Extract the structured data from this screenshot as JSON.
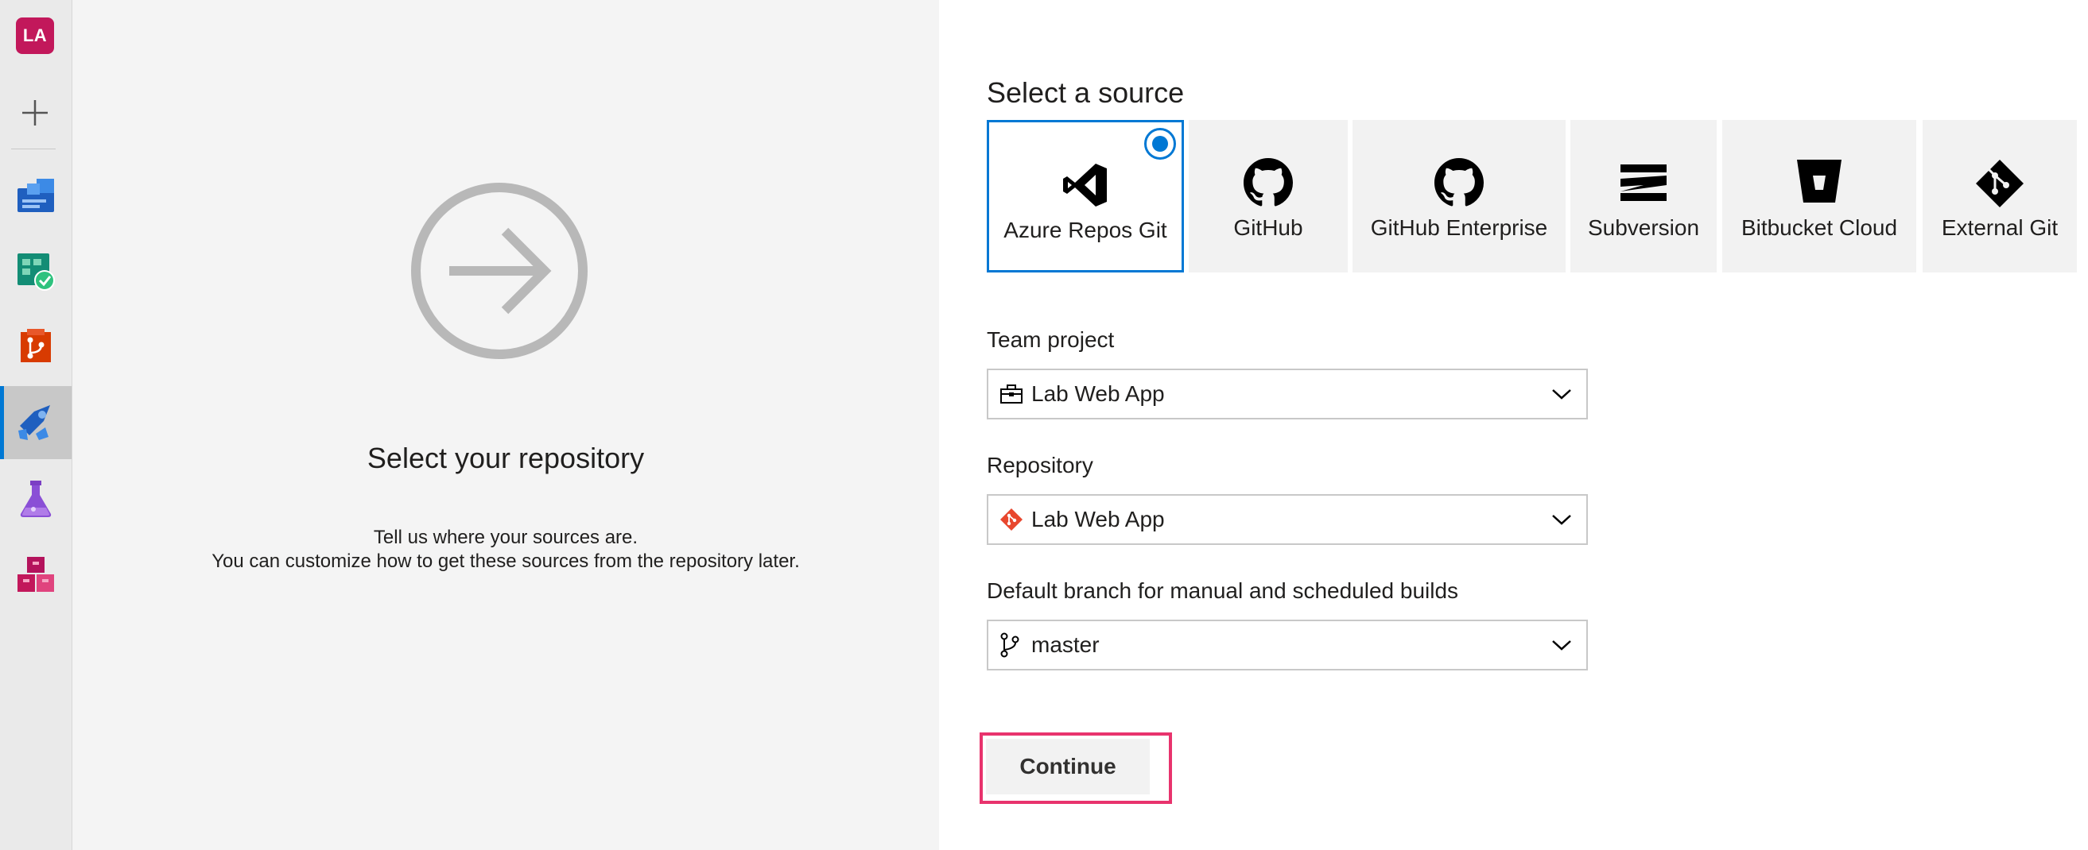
{
  "rail": {
    "avatar_initials": "LA",
    "items": [
      {
        "name": "overview-icon"
      },
      {
        "name": "boards-icon"
      },
      {
        "name": "repos-icon"
      },
      {
        "name": "pipelines-icon",
        "active": true
      },
      {
        "name": "test-plans-icon"
      },
      {
        "name": "artifacts-icon"
      }
    ]
  },
  "info": {
    "title": "Select your repository",
    "line1": "Tell us where your sources are.",
    "line2": "You can customize how to get these sources from the repository later."
  },
  "source": {
    "heading": "Select a source",
    "options": [
      {
        "label": "Azure Repos Git",
        "icon": "azure-repos-icon",
        "selected": true
      },
      {
        "label": "GitHub",
        "icon": "github-icon",
        "selected": false
      },
      {
        "label": "GitHub Enterprise",
        "icon": "github-enterprise-icon",
        "selected": false
      },
      {
        "label": "Subversion",
        "icon": "subversion-icon",
        "selected": false
      },
      {
        "label": "Bitbucket Cloud",
        "icon": "bitbucket-icon",
        "selected": false
      },
      {
        "label": "External Git",
        "icon": "git-icon",
        "selected": false
      }
    ]
  },
  "form": {
    "team_project": {
      "label": "Team project",
      "value": "Lab Web App"
    },
    "repository": {
      "label": "Repository",
      "value": "Lab Web App"
    },
    "branch": {
      "label": "Default branch for manual and scheduled builds",
      "value": "master"
    }
  },
  "continue_label": "Continue",
  "colors": {
    "accent": "#0078d4",
    "highlight": "#e8336d",
    "avatar": "#c2185b"
  }
}
